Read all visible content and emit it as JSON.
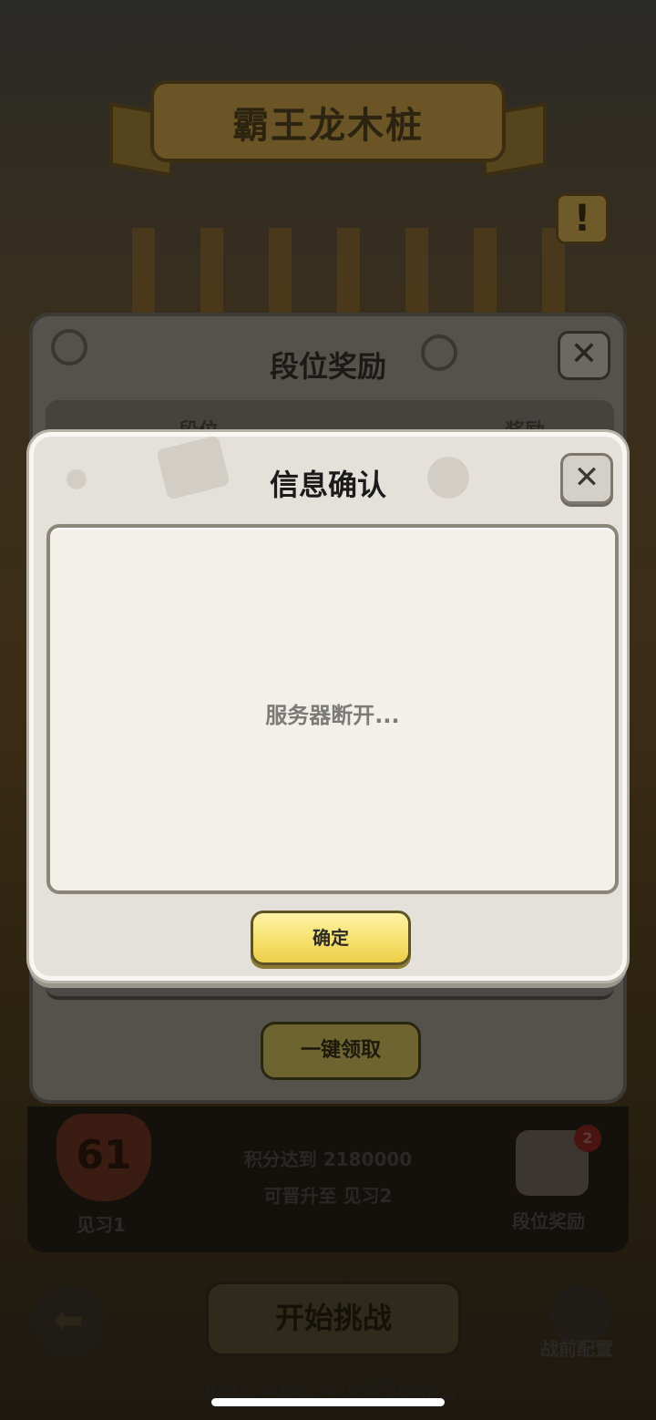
{
  "background": {
    "banner_title": "霸王龙木桩",
    "info_badge": "!"
  },
  "rank_panel": {
    "title": "段位奖励",
    "close_glyph": "✕",
    "col_rank": "段位",
    "col_reward": "奖励",
    "claim_all": "一键领取"
  },
  "rank_strip": {
    "level": "61",
    "rank_name": "见习1",
    "progress_line1": "积分达到 2180000",
    "progress_line2": "可晋升至 见习2",
    "reward_badge": "2",
    "reward_label": "段位奖励"
  },
  "footer": {
    "back_glyph": "⬅",
    "start_label": "开始挑战",
    "prep_label": "战前配置",
    "hint": "挑战生存越长可获得更高积分"
  },
  "dialog": {
    "title": "信息确认",
    "close_glyph": "✕",
    "message": "服务器断开...",
    "confirm_label": "确定"
  }
}
